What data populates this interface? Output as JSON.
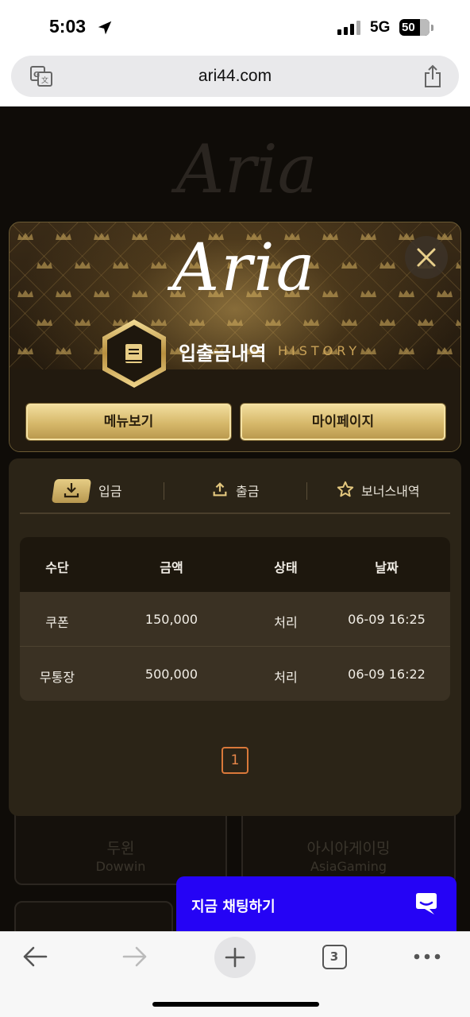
{
  "status_bar": {
    "time": "5:03",
    "network": "5G",
    "battery": "50"
  },
  "browser": {
    "url": "ari44.com",
    "tab_count": "3"
  },
  "background": {
    "logo": "Aria",
    "cards": [
      {
        "name_ko": "두윈",
        "name_en": "Dowwin"
      },
      {
        "name_ko": "아시아게이밍",
        "name_en": "AsiaGaming"
      }
    ]
  },
  "modal": {
    "logo": "Aria",
    "title": "입출금내역",
    "title_en": "HISTORY",
    "buttons": {
      "menu": "메뉴보기",
      "mypage": "마이페이지"
    },
    "tabs": [
      {
        "label": "입금",
        "icon": "download-icon",
        "active": true
      },
      {
        "label": "출금",
        "icon": "upload-icon",
        "active": false
      },
      {
        "label": "보너스내역",
        "icon": "star-icon",
        "active": false
      }
    ],
    "table": {
      "headers": [
        "수단",
        "금액",
        "상태",
        "날짜"
      ],
      "rows": [
        [
          "쿠폰",
          "150,000",
          "처리",
          "06-09 16:25"
        ],
        [
          "무통장",
          "500,000",
          "처리",
          "06-09 16:22"
        ]
      ]
    },
    "pagination": {
      "current": "1"
    }
  },
  "chat": {
    "label": "지금 채팅하기"
  },
  "colors": {
    "gold": "#c9a257",
    "chat_blue": "#2503f5",
    "pagination_orange": "#d9783a"
  }
}
